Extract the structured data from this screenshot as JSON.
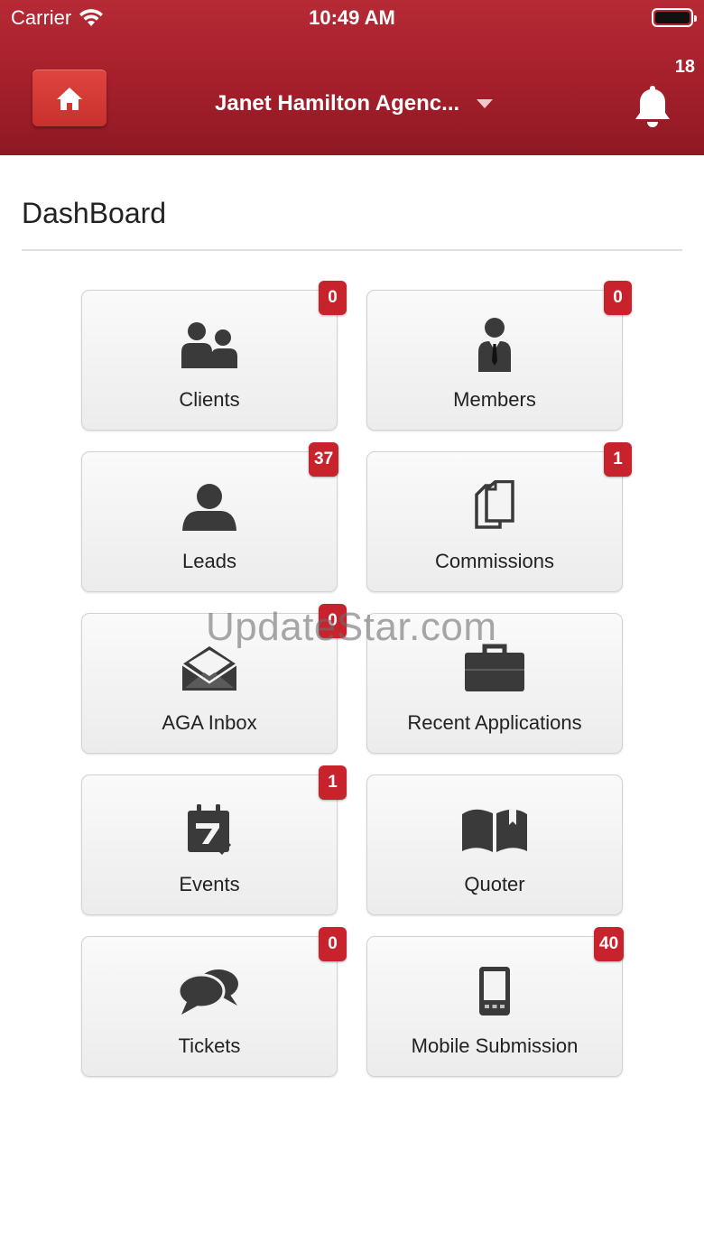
{
  "status_bar": {
    "carrier": "Carrier",
    "time": "10:49 AM"
  },
  "header": {
    "agency_name": "Janet Hamilton Agenc...",
    "notification_count": "18"
  },
  "page_title": "DashBoard",
  "tiles": [
    {
      "label": "Clients",
      "badge": "0",
      "icon": "clients-icon"
    },
    {
      "label": "Members",
      "badge": "0",
      "icon": "member-icon"
    },
    {
      "label": "Leads",
      "badge": "37",
      "icon": "person-icon"
    },
    {
      "label": "Commissions",
      "badge": "1",
      "icon": "documents-icon"
    },
    {
      "label": "AGA Inbox",
      "badge": "0",
      "icon": "envelope-icon"
    },
    {
      "label": "Recent Applications",
      "icon": "briefcase-icon"
    },
    {
      "label": "Events",
      "badge": "1",
      "icon": "calendar-icon"
    },
    {
      "label": "Quoter",
      "icon": "book-icon"
    },
    {
      "label": "Tickets",
      "badge": "0",
      "icon": "chat-bubbles-icon"
    },
    {
      "label": "Mobile Submission",
      "badge": "40",
      "icon": "mobile-phone-icon"
    }
  ],
  "watermark": "UpdateStar.com",
  "colors": {
    "header": "#a41f2b",
    "badge": "#c8222c",
    "home_button": "#d33a36",
    "icon": "#3a3a3a"
  }
}
